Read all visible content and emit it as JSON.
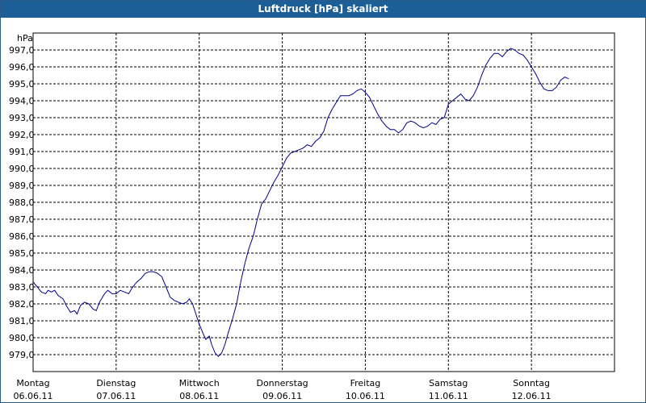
{
  "chart_data": {
    "type": "line",
    "title": "Luftdruck [hPa] skaliert",
    "ylabel": "hPa",
    "ylim": [
      978.0,
      998.0
    ],
    "y_ticks": [
      "979,0",
      "980,0",
      "981,0",
      "982,0",
      "983,0",
      "984,0",
      "985,0",
      "986,0",
      "987,0",
      "988,0",
      "989,0",
      "990,0",
      "991,0",
      "992,0",
      "993,0",
      "994,0",
      "995,0",
      "996,0",
      "997,0"
    ],
    "x_range_days": [
      0,
      7
    ],
    "x_labels": [
      {
        "day": "Montag",
        "date": "06.06.11"
      },
      {
        "day": "Dienstag",
        "date": "07.06.11"
      },
      {
        "day": "Mittwoch",
        "date": "08.06.11"
      },
      {
        "day": "Donnerstag",
        "date": "09.06.11"
      },
      {
        "day": "Freitag",
        "date": "10.06.11"
      },
      {
        "day": "Samstag",
        "date": "11.06.11"
      },
      {
        "day": "Sonntag",
        "date": "12.06.11"
      }
    ],
    "grid": true,
    "line_color": "#00008b",
    "series": [
      {
        "values": [
          [
            0.0,
            983.3
          ],
          [
            0.05,
            983.0
          ],
          [
            0.1,
            982.7
          ],
          [
            0.15,
            982.6
          ],
          [
            0.18,
            982.8
          ],
          [
            0.22,
            982.7
          ],
          [
            0.26,
            982.8
          ],
          [
            0.3,
            982.5
          ],
          [
            0.36,
            982.3
          ],
          [
            0.4,
            981.9
          ],
          [
            0.45,
            981.5
          ],
          [
            0.5,
            981.6
          ],
          [
            0.53,
            981.4
          ],
          [
            0.57,
            981.9
          ],
          [
            0.62,
            982.1
          ],
          [
            0.67,
            982.0
          ],
          [
            0.72,
            981.7
          ],
          [
            0.76,
            981.6
          ],
          [
            0.8,
            982.1
          ],
          [
            0.86,
            982.6
          ],
          [
            0.9,
            982.8
          ],
          [
            0.95,
            982.6
          ],
          [
            1.0,
            982.6
          ],
          [
            1.05,
            982.8
          ],
          [
            1.1,
            982.7
          ],
          [
            1.15,
            982.6
          ],
          [
            1.2,
            983.0
          ],
          [
            1.25,
            983.3
          ],
          [
            1.3,
            983.5
          ],
          [
            1.35,
            983.8
          ],
          [
            1.4,
            983.9
          ],
          [
            1.45,
            983.9
          ],
          [
            1.5,
            983.8
          ],
          [
            1.55,
            983.6
          ],
          [
            1.6,
            983.0
          ],
          [
            1.65,
            982.4
          ],
          [
            1.7,
            982.2
          ],
          [
            1.75,
            982.1
          ],
          [
            1.8,
            982.0
          ],
          [
            1.85,
            982.1
          ],
          [
            1.88,
            982.3
          ],
          [
            1.92,
            982.0
          ],
          [
            1.96,
            981.4
          ],
          [
            2.0,
            980.8
          ],
          [
            2.05,
            980.2
          ],
          [
            2.08,
            979.9
          ],
          [
            2.12,
            980.1
          ],
          [
            2.15,
            979.6
          ],
          [
            2.19,
            979.1
          ],
          [
            2.23,
            978.9
          ],
          [
            2.27,
            979.1
          ],
          [
            2.31,
            979.6
          ],
          [
            2.35,
            980.3
          ],
          [
            2.4,
            981.1
          ],
          [
            2.45,
            982.0
          ],
          [
            2.5,
            983.3
          ],
          [
            2.55,
            984.4
          ],
          [
            2.6,
            985.3
          ],
          [
            2.65,
            986.0
          ],
          [
            2.7,
            987.0
          ],
          [
            2.75,
            987.9
          ],
          [
            2.8,
            988.2
          ],
          [
            2.85,
            988.7
          ],
          [
            2.9,
            989.2
          ],
          [
            2.95,
            989.6
          ],
          [
            3.0,
            990.1
          ],
          [
            3.05,
            990.6
          ],
          [
            3.1,
            990.9
          ],
          [
            3.15,
            991.0
          ],
          [
            3.2,
            991.1
          ],
          [
            3.25,
            991.2
          ],
          [
            3.3,
            991.4
          ],
          [
            3.35,
            991.3
          ],
          [
            3.4,
            991.6
          ],
          [
            3.45,
            991.8
          ],
          [
            3.5,
            992.2
          ],
          [
            3.55,
            993.0
          ],
          [
            3.6,
            993.5
          ],
          [
            3.65,
            993.9
          ],
          [
            3.7,
            994.3
          ],
          [
            3.75,
            994.3
          ],
          [
            3.8,
            994.3
          ],
          [
            3.85,
            994.4
          ],
          [
            3.9,
            994.6
          ],
          [
            3.95,
            994.7
          ],
          [
            4.0,
            994.5
          ],
          [
            4.05,
            994.2
          ],
          [
            4.1,
            993.7
          ],
          [
            4.15,
            993.2
          ],
          [
            4.2,
            992.8
          ],
          [
            4.25,
            992.5
          ],
          [
            4.3,
            992.3
          ],
          [
            4.35,
            992.3
          ],
          [
            4.4,
            992.1
          ],
          [
            4.45,
            992.3
          ],
          [
            4.5,
            992.7
          ],
          [
            4.55,
            992.8
          ],
          [
            4.6,
            992.7
          ],
          [
            4.65,
            992.5
          ],
          [
            4.7,
            992.4
          ],
          [
            4.75,
            992.5
          ],
          [
            4.8,
            992.7
          ],
          [
            4.85,
            992.6
          ],
          [
            4.9,
            992.9
          ],
          [
            4.95,
            993.0
          ],
          [
            5.0,
            993.8
          ],
          [
            5.05,
            994.0
          ],
          [
            5.1,
            994.2
          ],
          [
            5.15,
            994.4
          ],
          [
            5.2,
            994.1
          ],
          [
            5.25,
            994.0
          ],
          [
            5.3,
            994.3
          ],
          [
            5.35,
            994.8
          ],
          [
            5.4,
            995.5
          ],
          [
            5.45,
            996.1
          ],
          [
            5.5,
            996.5
          ],
          [
            5.55,
            996.8
          ],
          [
            5.6,
            996.8
          ],
          [
            5.65,
            996.6
          ],
          [
            5.7,
            996.9
          ],
          [
            5.75,
            997.1
          ],
          [
            5.8,
            997.0
          ],
          [
            5.85,
            996.8
          ],
          [
            5.9,
            996.7
          ],
          [
            5.95,
            996.4
          ],
          [
            6.0,
            996.0
          ],
          [
            6.05,
            995.6
          ],
          [
            6.1,
            995.1
          ],
          [
            6.15,
            994.7
          ],
          [
            6.2,
            994.6
          ],
          [
            6.25,
            994.6
          ],
          [
            6.3,
            994.8
          ],
          [
            6.35,
            995.2
          ],
          [
            6.4,
            995.4
          ],
          [
            6.45,
            995.3
          ]
        ]
      }
    ]
  }
}
